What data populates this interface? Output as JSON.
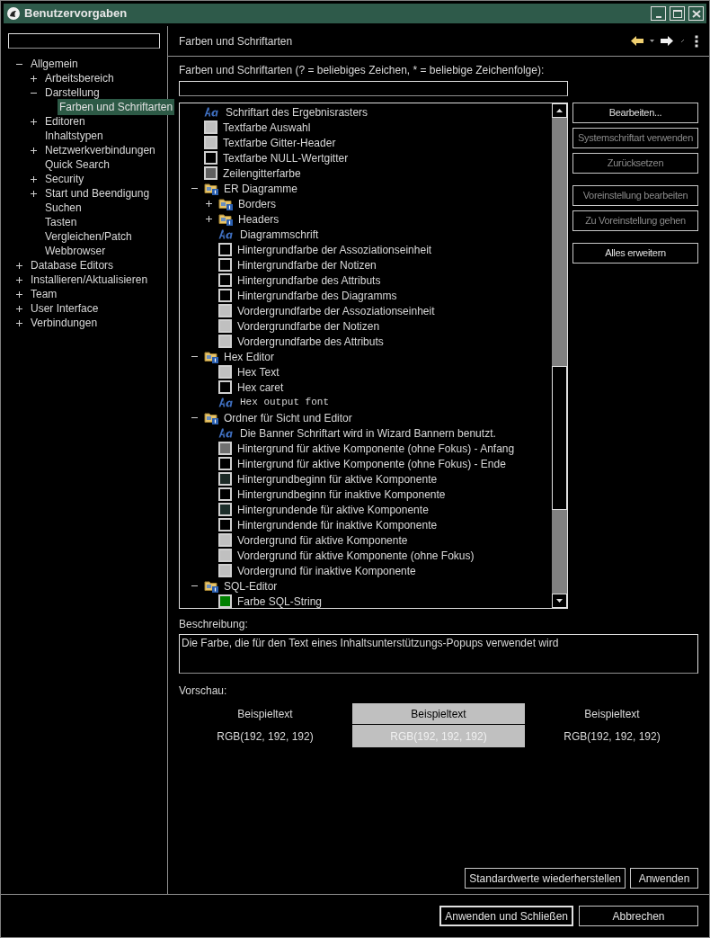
{
  "window": {
    "title": "Benutzervorgaben"
  },
  "nav": {
    "items": [
      {
        "label": "Allgemein",
        "expanded": true,
        "selected": false,
        "children": [
          {
            "label": "Arbeitsbereich",
            "expanded": false,
            "selected": false
          },
          {
            "label": "Darstellung",
            "expanded": true,
            "selected": false,
            "children": [
              {
                "label": "Farben und Schriftarten",
                "selected": true
              }
            ]
          },
          {
            "label": "Editoren",
            "expanded": false,
            "selected": false
          },
          {
            "label": "Inhaltstypen",
            "selected": false
          },
          {
            "label": "Netzwerkverbindungen",
            "expanded": false,
            "selected": false
          },
          {
            "label": "Quick Search",
            "selected": false
          },
          {
            "label": "Security",
            "expanded": false,
            "selected": false
          },
          {
            "label": "Start und Beendigung",
            "expanded": false,
            "selected": false
          },
          {
            "label": "Suchen",
            "selected": false
          },
          {
            "label": "Tasten",
            "selected": false
          },
          {
            "label": "Vergleichen/Patch",
            "selected": false
          },
          {
            "label": "Webbrowser",
            "selected": false
          }
        ]
      },
      {
        "label": "Database Editors",
        "expanded": false,
        "selected": false
      },
      {
        "label": "Installieren/Aktualisieren",
        "expanded": false,
        "selected": false
      },
      {
        "label": "Team",
        "expanded": false,
        "selected": false
      },
      {
        "label": "User Interface",
        "expanded": false,
        "selected": false
      },
      {
        "label": "Verbindungen",
        "expanded": false,
        "selected": false
      }
    ]
  },
  "page": {
    "title": "Farben und Schriftarten",
    "filter_label": "Farben und Schriftarten (? = beliebiges Zeichen, * = beliebige Zeichenfolge):"
  },
  "tree": [
    {
      "kind": "font",
      "label": "Schriftart des Ergebnisrasters"
    },
    {
      "kind": "color",
      "label": "Textfarbe Auswahl",
      "color": "#c0c0c0"
    },
    {
      "kind": "color",
      "label": "Textfarbe Gitter-Header",
      "color": "#c0c0c0"
    },
    {
      "kind": "color",
      "label": "Textfarbe NULL-Wertgitter",
      "color": "#000000"
    },
    {
      "kind": "color",
      "label": "Zeilengitterfarbe",
      "color": "#606060"
    },
    {
      "kind": "folder",
      "label": "ER Diagramme",
      "expanded": true,
      "children": [
        {
          "kind": "folder",
          "label": "Borders",
          "expanded": false
        },
        {
          "kind": "folder",
          "label": "Headers",
          "expanded": false
        },
        {
          "kind": "font",
          "label": "Diagrammschrift"
        },
        {
          "kind": "color",
          "label": "Hintergrundfarbe der Assoziationseinheit",
          "color": "#000000"
        },
        {
          "kind": "color",
          "label": "Hintergrundfarbe der Notizen",
          "color": "#000000"
        },
        {
          "kind": "color",
          "label": "Hintergrundfarbe des Attributs",
          "color": "#000000"
        },
        {
          "kind": "color",
          "label": "Hintergrundfarbe des Diagramms",
          "color": "#000000"
        },
        {
          "kind": "color",
          "label": "Vordergrundfarbe der Assoziationseinheit",
          "color": "#c0c0c0"
        },
        {
          "kind": "color",
          "label": "Vordergrundfarbe der Notizen",
          "color": "#c0c0c0"
        },
        {
          "kind": "color",
          "label": "Vordergrundfarbe des Attributs",
          "color": "#c0c0c0"
        }
      ]
    },
    {
      "kind": "folder",
      "label": "Hex Editor",
      "expanded": true,
      "children": [
        {
          "kind": "color",
          "label": "Hex Text",
          "color": "#c0c0c0"
        },
        {
          "kind": "color",
          "label": "Hex caret",
          "color": "#000000"
        },
        {
          "kind": "font",
          "label": "Hex output font",
          "monospace": true
        }
      ]
    },
    {
      "kind": "folder",
      "label": "Ordner für Sicht und Editor",
      "expanded": true,
      "children": [
        {
          "kind": "font",
          "label": "Die Banner Schriftart wird in Wizard Bannern benutzt."
        },
        {
          "kind": "color",
          "label": "Hintergrund für aktive Komponente (ohne Fokus) - Anfang",
          "color": "#707070"
        },
        {
          "kind": "color",
          "label": "Hintergrund für aktive Komponente (ohne Fokus) - Ende",
          "color": "#000000"
        },
        {
          "kind": "color",
          "label": "Hintergrundbeginn für aktive Komponente",
          "color": "#1c2a26"
        },
        {
          "kind": "color",
          "label": "Hintergrundbeginn für inaktive Komponente",
          "color": "#000000"
        },
        {
          "kind": "color",
          "label": "Hintergrundende für aktive Komponente",
          "color": "#1c2e2a"
        },
        {
          "kind": "color",
          "label": "Hintergrundende für inaktive Komponente",
          "color": "#000000"
        },
        {
          "kind": "color",
          "label": "Vordergrund für aktive Komponente",
          "color": "#c0c0c0"
        },
        {
          "kind": "color",
          "label": "Vordergrund für aktive Komponente (ohne Fokus)",
          "color": "#c0c0c0"
        },
        {
          "kind": "color",
          "label": "Vordergrund für inaktive Komponente",
          "color": "#c0c0c0"
        }
      ]
    },
    {
      "kind": "folder",
      "label": "SQL-Editor",
      "expanded": true,
      "children": [
        {
          "kind": "color",
          "label": "Farbe SQL-String",
          "color": "#008000"
        }
      ]
    }
  ],
  "side_button_groups": [
    [
      {
        "label": "Bearbeiten...",
        "disabled": false
      },
      {
        "label": "Systemschriftart verwenden",
        "disabled": true
      },
      {
        "label": "Zurücksetzen",
        "disabled": true
      }
    ],
    [
      {
        "label": "Voreinstellung bearbeiten",
        "disabled": true
      },
      {
        "label": "Zu Voreinstellung gehen",
        "disabled": true
      }
    ],
    [
      {
        "label": "Alles erweitern",
        "disabled": false
      }
    ]
  ],
  "description": {
    "label": "Beschreibung:",
    "text": "Die Farbe, die für den Text eines Inhaltsunterstützungs-Popups verwendet wird"
  },
  "preview": {
    "label": "Vorschau:",
    "columns": [
      {
        "sample": "Beispieltext",
        "rgb": "RGB(192, 192, 192)",
        "selected": false
      },
      {
        "sample": "Beispieltext",
        "rgb": "RGB(192, 192, 192)",
        "selected": true
      },
      {
        "sample": "Beispieltext",
        "rgb": "RGB(192, 192, 192)",
        "selected": false
      }
    ]
  },
  "page_buttons": [
    "Standardwerte wiederherstellen",
    "Anwenden"
  ],
  "dialog_buttons": [
    {
      "label": "Anwenden und Schließen",
      "default": true
    },
    {
      "label": "Abbrechen",
      "default": false
    }
  ]
}
